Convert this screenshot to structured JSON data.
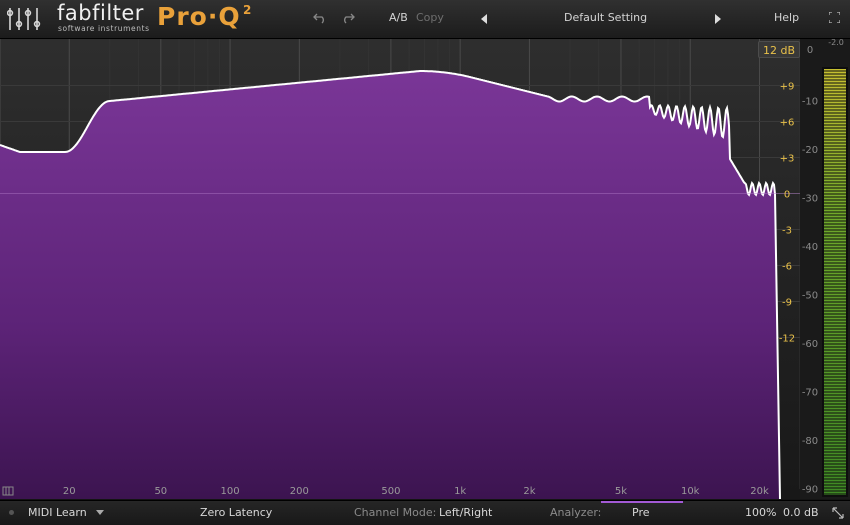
{
  "header": {
    "brand": "fabfilter",
    "brand_sub": "software instruments",
    "product": "Pro·Q",
    "product_version": "2",
    "ab_label": "A/B",
    "copy_label": "Copy",
    "preset_name": "Default Setting",
    "help_label": "Help"
  },
  "graph": {
    "range_label": "12 dB",
    "top_meter_label": "0",
    "top_scale_label": "-2.0",
    "eq_scale": [
      "+9",
      "+6",
      "+3",
      "0",
      "-3",
      "-6",
      "-9",
      "-12"
    ],
    "eq_values": [
      9,
      6,
      3,
      0,
      -3,
      -6,
      -9,
      -12
    ],
    "analyzer_scale": [
      "-10",
      "-20",
      "-30",
      "-40",
      "-50",
      "-60",
      "-70",
      "-80",
      "-90"
    ],
    "analyzer_values": [
      -10,
      -20,
      -30,
      -40,
      -50,
      -60,
      -70,
      -80,
      -90
    ],
    "freq_labels": [
      "20",
      "50",
      "100",
      "200",
      "500",
      "1k",
      "2k",
      "5k",
      "10k",
      "20k"
    ],
    "freq_values": [
      20,
      50,
      100,
      200,
      500,
      1000,
      2000,
      5000,
      10000,
      20000
    ],
    "curve_color": "#ffffff",
    "fill_color": "#6a2a86",
    "accent_label_color": "#e9c14a"
  },
  "footer": {
    "midi_learn": "MIDI Learn",
    "latency": "Zero Latency",
    "channel_mode_label": "Channel Mode:",
    "channel_mode_value": "Left/Right",
    "analyzer_label": "Analyzer:",
    "analyzer_value": "Pre",
    "zoom": "100%",
    "output_gain": "0.0 dB"
  }
}
